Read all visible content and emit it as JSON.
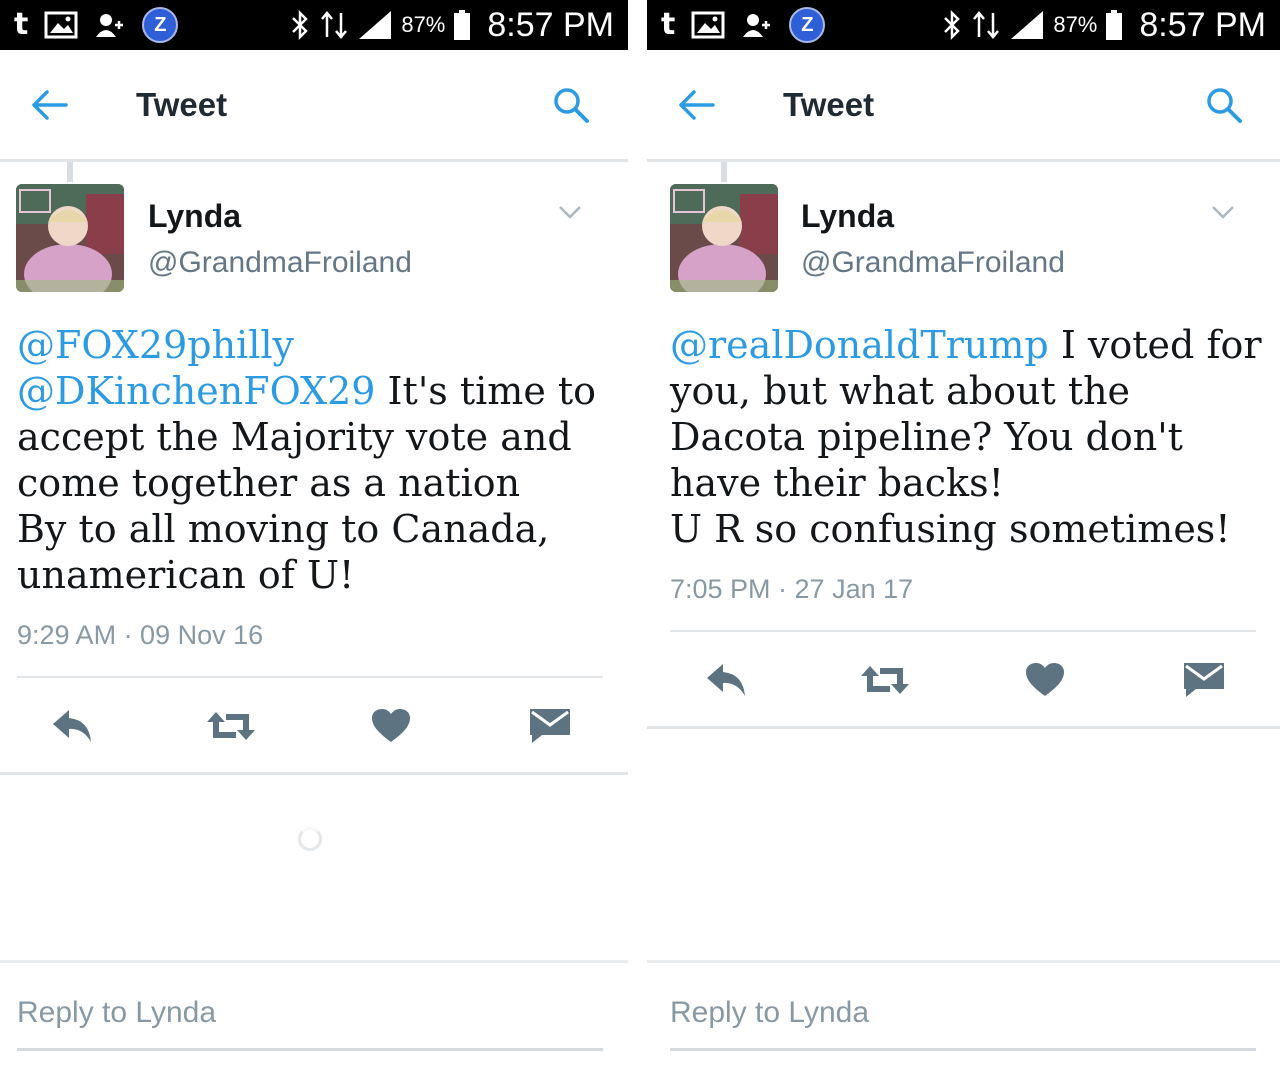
{
  "colors": {
    "accent": "#2d9be3",
    "icon_gray": "#5e7382",
    "status_bg": "#000000"
  },
  "screens": [
    {
      "status": {
        "battery": "87%",
        "time": "8:57 PM"
      },
      "header": {
        "title": "Tweet"
      },
      "tweet": {
        "name": "Lynda",
        "handle": "@GrandmaFroiland",
        "mention1": "@FOX29philly",
        "mention2": "@DKinchenFOX29",
        "text": " It's time to accept the Majority vote and come together as a nation\nBy to all moving to Canada, unamerican of U!",
        "timestamp": "9:29 AM · 09 Nov 16"
      },
      "reply": {
        "placeholder": "Reply to Lynda"
      }
    },
    {
      "status": {
        "battery": "87%",
        "time": "8:57 PM"
      },
      "header": {
        "title": "Tweet"
      },
      "tweet": {
        "name": "Lynda",
        "handle": "@GrandmaFroiland",
        "mention1": "@realDonaldTrump",
        "text": " I voted for you, but what about the Dacota pipeline? You don't have their backs!\nU R so confusing sometimes!",
        "timestamp": "7:05 PM · 27 Jan 17"
      },
      "reply": {
        "placeholder": "Reply to Lynda"
      }
    }
  ],
  "icons": {
    "status_left": [
      "tumblr-icon",
      "image-icon",
      "contact-add-icon",
      "z-app-icon"
    ],
    "status_right": [
      "bluetooth-icon",
      "data-icon",
      "signal-icon",
      "battery-icon"
    ],
    "actions": [
      "reply-icon",
      "retweet-icon",
      "like-icon",
      "message-icon"
    ]
  }
}
